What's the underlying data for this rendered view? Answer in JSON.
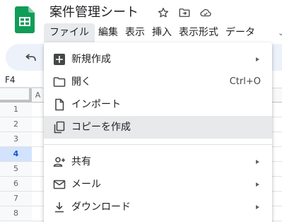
{
  "header": {
    "title": "案件管理シート",
    "icons": [
      "sheets-logo",
      "star-icon",
      "move-to-folder-icon",
      "cloud-status-icon"
    ]
  },
  "menubar": {
    "items": [
      {
        "label": "ファイル",
        "active": true
      },
      {
        "label": "編集"
      },
      {
        "label": "表示"
      },
      {
        "label": "挿入"
      },
      {
        "label": "表示形式"
      },
      {
        "label": "データ"
      }
    ]
  },
  "toolbar": {
    "undo_icon": "undo-icon"
  },
  "name_box": {
    "value": "F4"
  },
  "grid": {
    "column_headers": [
      "A"
    ],
    "row_headers": [
      "1",
      "2",
      "3",
      "4",
      "5",
      "6",
      "7",
      "8"
    ],
    "selected_row": "4"
  },
  "file_menu": {
    "items": [
      {
        "label": "新規作成",
        "icon": "new-spreadsheet-icon",
        "submenu": true
      },
      {
        "label": "開く",
        "icon": "folder-icon",
        "shortcut": "Ctrl+O"
      },
      {
        "label": "インポート",
        "icon": "file-icon"
      },
      {
        "label": "コピーを作成",
        "icon": "copy-icon",
        "hovered": true
      },
      {
        "label": "共有",
        "icon": "person-add-icon",
        "submenu": true
      },
      {
        "label": "メール",
        "icon": "mail-icon",
        "submenu": true
      },
      {
        "label": "ダウンロード",
        "icon": "download-icon",
        "submenu": true
      }
    ]
  },
  "colors": {
    "sheets_green": "#0f9d58",
    "toolbar_bg": "#edf2fa",
    "menu_active_bg": "#e8eaed",
    "hover_bg": "#e8e9eb",
    "selected_row_bg": "#d3e3fd"
  }
}
